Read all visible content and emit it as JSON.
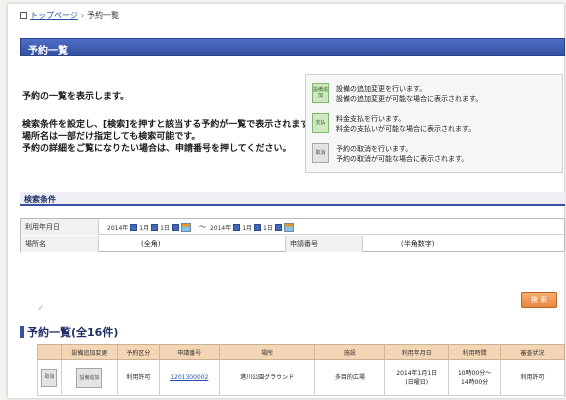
{
  "breadcrumb": {
    "home": "トップページ",
    "separator": "›",
    "current": "予約一覧"
  },
  "page_title": "予約一覧",
  "intro": {
    "line1": "予約の一覧を表示します。",
    "line2": "検索条件を設定し、[検索]を押すと該当する予約が一覧で表示されます。",
    "line3": "場所名は一部だけ指定しても検索可能です。",
    "line4": "予約の詳細をご覧になりたい場合は、申請番号を押してください。"
  },
  "legend": [
    {
      "button": "設備追加",
      "color": "green",
      "line1": "設備の追加変更を行います。",
      "line2": "設備の追加変更が可能な場合に表示されます。"
    },
    {
      "button": "支払",
      "color": "green",
      "line1": "料金支払を行います。",
      "line2": "料金の支払いが可能な場合に表示されます。"
    },
    {
      "button": "取消",
      "color": "gray",
      "line1": "予約の取消を行います。",
      "line2": "予約の取消が可能な場合に表示されます。"
    }
  ],
  "search_section_title": "検索条件",
  "search": {
    "date_label": "利用年月日",
    "from": {
      "year": "2014年",
      "month": "1月",
      "day": "1日"
    },
    "range_sep": "～",
    "to": {
      "year": "2014年",
      "month": "1月",
      "day": "1日"
    },
    "place_label": "場所名",
    "place_value": "(全角)",
    "appno_label": "申請番号",
    "appno_value": "(半角数字)",
    "button": "検 索"
  },
  "results": {
    "heading": "予約一覧(全16件)",
    "columns": [
      "設備追加変更",
      "予約区分",
      "申請番号",
      "場所",
      "施設",
      "利用年月日",
      "利用時間",
      "審査状況"
    ],
    "rows": [
      {
        "action_button": "取消",
        "equipment_button": "設備追加",
        "type": "利用許可",
        "app_no": "1201300002",
        "place": "港川公園グラウンド",
        "facility": "多目的広場",
        "date_line1": "2014年1月1日",
        "date_line2": "(日曜日)",
        "time_line1": "10時00分～",
        "time_line2": "14時00分",
        "status": "利用許可"
      }
    ]
  },
  "colors": {
    "title_bar": "#3451a3",
    "header_bg": "#f4d6b4",
    "search_button": "#e8853f",
    "legend_green": "#cfe7c2"
  }
}
